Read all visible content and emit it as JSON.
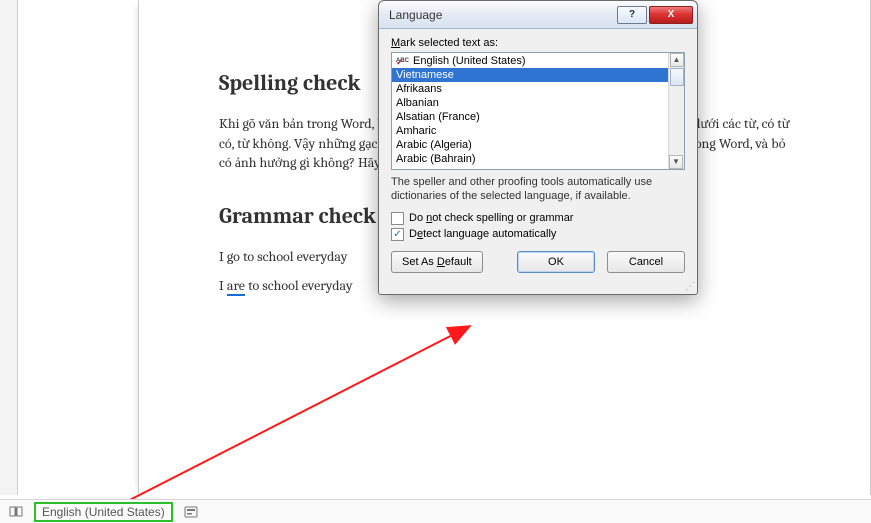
{
  "document": {
    "heading1": "Spelling check",
    "para1": "Khi gõ văn bản trong Word, bạn sẽ thấy các gạch chân màu đỏ, màu xanh xuất hiện dưới các từ, có từ có, từ không. Vậy những gạch chân này là gì, có ý nghĩa gì, do tính năng nào tạo ra trong Word, và bỏ có ảnh hưởng gì không? Hãy đọc bài viết.",
    "heading2": "Grammar check",
    "para2_pre": "I go to school everyday",
    "para3_pre": "I ",
    "para3_err": "are",
    "para3_post": " to school everyday"
  },
  "dialog": {
    "title": "Language",
    "help_symbol": "?",
    "close_symbol": "X",
    "mark_label_pre": "Mark selected text as:",
    "languages": [
      {
        "name": "English (United States)",
        "check": true
      },
      {
        "name": "Vietnamese",
        "selected": true
      },
      {
        "name": "Afrikaans"
      },
      {
        "name": "Albanian"
      },
      {
        "name": "Alsatian (France)"
      },
      {
        "name": "Amharic"
      },
      {
        "name": "Arabic (Algeria)"
      },
      {
        "name": "Arabic (Bahrain)"
      }
    ],
    "hint": "The speller and other proofing tools automatically use dictionaries of the selected language, if available.",
    "chk_no_check": "Do not check spelling or grammar",
    "chk_detect": "Detect language automatically",
    "detect_checked": "✓",
    "btn_default": "Set As Default",
    "btn_ok": "OK",
    "btn_cancel": "Cancel",
    "scroll_up": "▲",
    "scroll_dn": "▼"
  },
  "statusbar": {
    "language": "English (United States)"
  }
}
